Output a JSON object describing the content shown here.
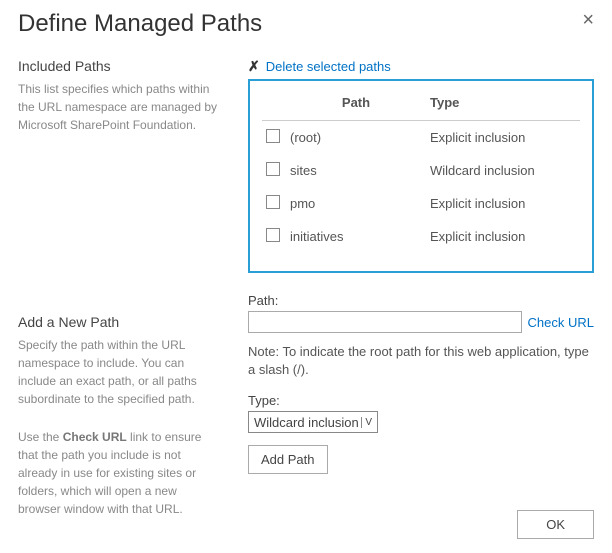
{
  "title": "Define Managed Paths",
  "left": {
    "included_heading": "Included Paths",
    "included_desc": "This list specifies which paths within the URL namespace are managed by Microsoft SharePoint Foundation.",
    "add_heading": "Add a New Path",
    "add_desc1": "Specify the path within the URL namespace to include. You can include an exact path, or all paths subordinate to the specified path.",
    "add_desc2_a": "Use the ",
    "add_desc2_b": "Check URL",
    "add_desc2_c": " link to ensure that the path you include is not already in use for existing sites or folders, which will open a new browser window with that URL."
  },
  "right": {
    "delete_link": "Delete selected paths",
    "table": {
      "col_path": "Path",
      "col_type": "Type",
      "rows": [
        {
          "path": "(root)",
          "type": "Explicit inclusion"
        },
        {
          "path": "sites",
          "type": "Wildcard inclusion"
        },
        {
          "path": "pmo",
          "type": "Explicit inclusion"
        },
        {
          "path": "initiatives",
          "type": "Explicit inclusion"
        }
      ]
    },
    "path_label": "Path:",
    "path_value": "",
    "check_url": "Check URL",
    "note": "Note: To indicate the root path for this web application, type a slash (/).",
    "type_label": "Type:",
    "type_selected": "Wildcard inclusion",
    "add_button": "Add Path",
    "ok_button": "OK"
  }
}
